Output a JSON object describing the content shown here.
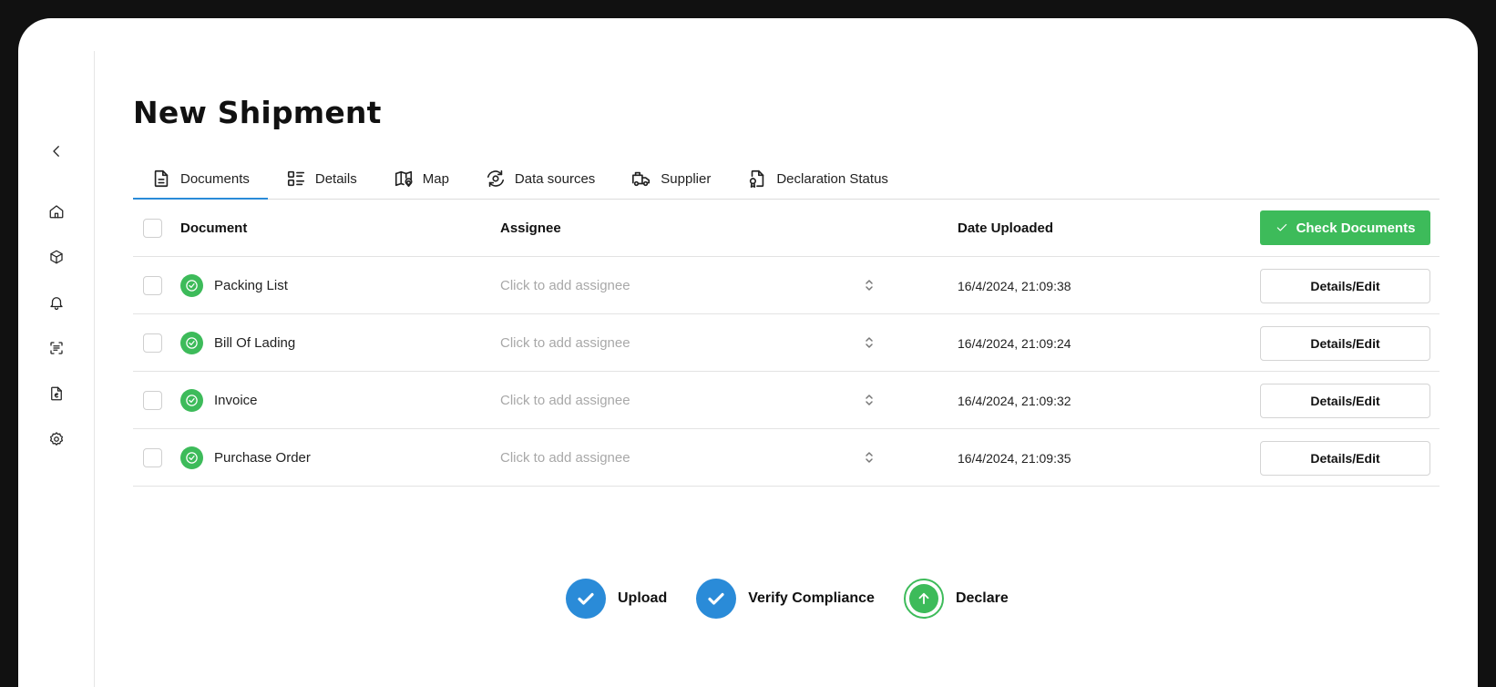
{
  "page": {
    "title": "New Shipment"
  },
  "sidebar": {
    "items": [
      {
        "name": "collapse",
        "icon": "chevron-left-icon"
      },
      {
        "name": "home",
        "icon": "home-icon"
      },
      {
        "name": "packages",
        "icon": "box-icon"
      },
      {
        "name": "notifications",
        "icon": "bell-icon"
      },
      {
        "name": "scan",
        "icon": "scan-icon"
      },
      {
        "name": "documents",
        "icon": "file-euro-icon"
      },
      {
        "name": "settings",
        "icon": "gear-icon"
      }
    ]
  },
  "tabs": [
    {
      "label": "Documents",
      "icon": "file-text-icon",
      "active": true
    },
    {
      "label": "Details",
      "icon": "list-icon",
      "active": false
    },
    {
      "label": "Map",
      "icon": "map-pin-icon",
      "active": false
    },
    {
      "label": "Data sources",
      "icon": "eye-refresh-icon",
      "active": false
    },
    {
      "label": "Supplier",
      "icon": "truck-icon",
      "active": false
    },
    {
      "label": "Declaration Status",
      "icon": "file-badge-icon",
      "active": false
    }
  ],
  "table": {
    "headers": {
      "document": "Document",
      "assignee": "Assignee",
      "date": "Date Uploaded"
    },
    "check_button_label": "Check Documents",
    "assignee_placeholder": "Click to add assignee",
    "edit_label": "Details/Edit",
    "rows": [
      {
        "document": "Packing List",
        "date": "16/4/2024, 21:09:38"
      },
      {
        "document": "Bill Of Lading",
        "date": "16/4/2024, 21:09:24"
      },
      {
        "document": "Invoice",
        "date": "16/4/2024, 21:09:32"
      },
      {
        "document": "Purchase Order",
        "date": "16/4/2024, 21:09:35"
      }
    ]
  },
  "steps": [
    {
      "label": "Upload",
      "state": "complete"
    },
    {
      "label": "Verify Compliance",
      "state": "complete"
    },
    {
      "label": "Declare",
      "state": "current"
    }
  ],
  "colors": {
    "accent_green": "#3dbb5a",
    "accent_blue": "#2a8bd8"
  }
}
